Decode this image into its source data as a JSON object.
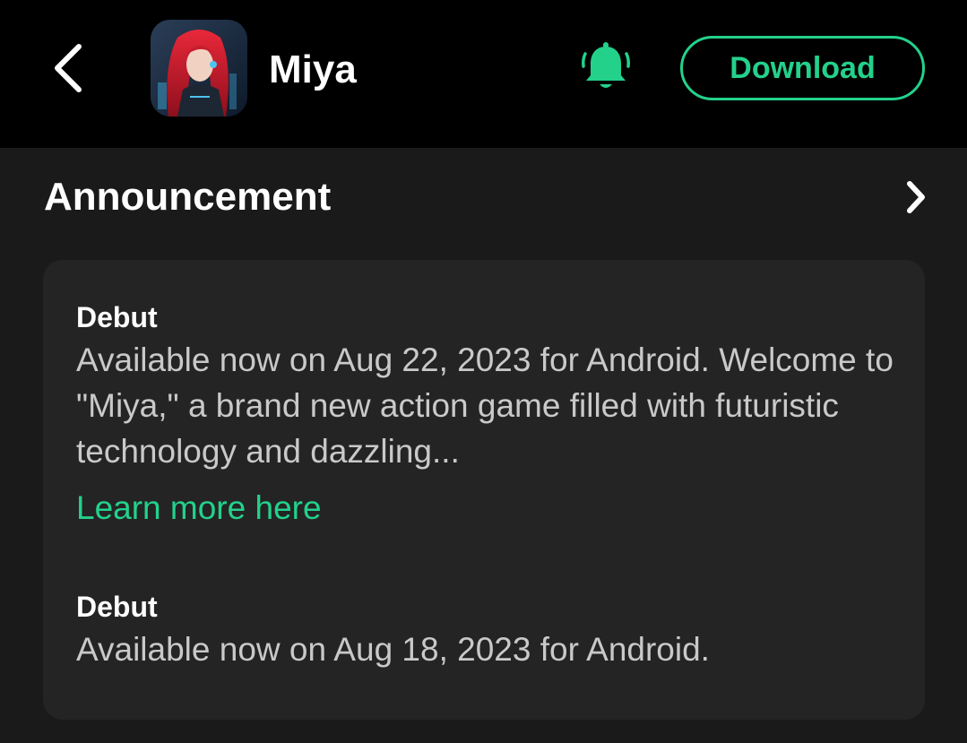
{
  "header": {
    "app_name": "Miya",
    "download_label": "Download",
    "icons": {
      "back": "chevron-left-icon",
      "bell": "bell-ringing-icon"
    }
  },
  "announcement": {
    "title": "Announcement",
    "items": [
      {
        "title": "Debut",
        "body": "Available now on Aug 22, 2023 for Android. Welcome to \"Miya,\" a brand new action game filled with futuristic technology and dazzling...",
        "link_label": "Learn more here"
      },
      {
        "title": "Debut",
        "body": "Available now on Aug 18, 2023 for Android."
      }
    ]
  },
  "colors": {
    "accent": "#23d18b",
    "header_bg": "#000000",
    "page_bg": "#1a1a1a",
    "card_bg": "#242424"
  }
}
